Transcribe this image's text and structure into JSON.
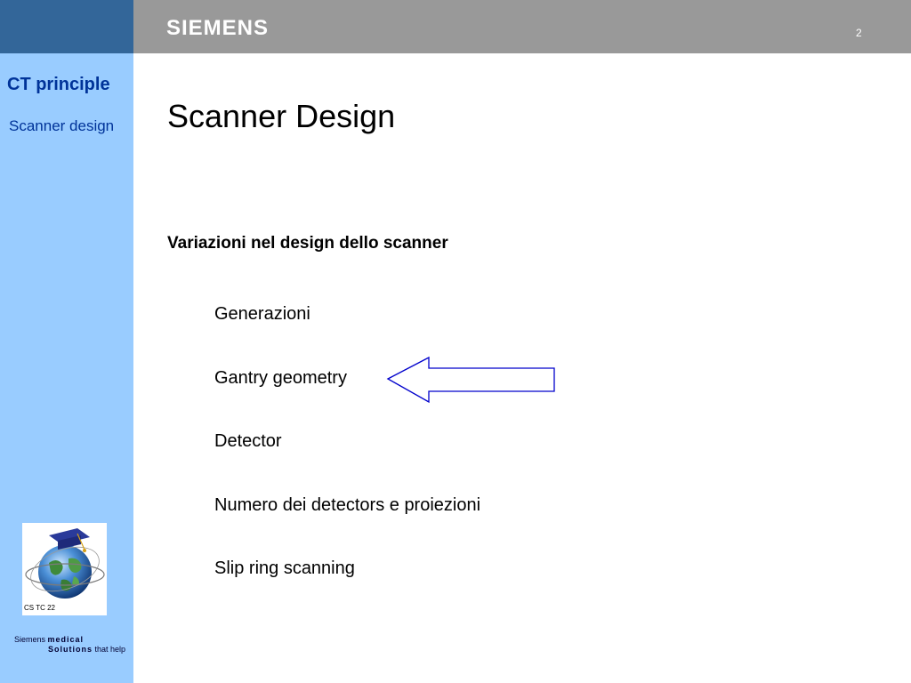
{
  "header": {
    "brand": "SIEMENS",
    "page_number": "2"
  },
  "sidebar": {
    "section_title": "CT principle",
    "section_subtitle": "Scanner design",
    "logo_caption": "CS TC 22",
    "footer": {
      "company": "Siemens",
      "word_medical": "medical",
      "word_solutions": "Solutions",
      "tagline_end": "that help"
    }
  },
  "slide": {
    "title": "Scanner Design",
    "subheading": "Variazioni nel design dello scanner",
    "bullets": [
      "Generazioni",
      "Gantry geometry",
      "Detector",
      "Numero dei detectors e proiezioni",
      "Slip ring scanning"
    ]
  },
  "colors": {
    "sidebar": "#99ccff",
    "sidebar_top": "#336699",
    "header_bar": "#999999",
    "section_text": "#003399",
    "arrow_stroke": "#0000cc"
  },
  "icons": {
    "arrow": "left-arrow-icon",
    "logo": "globe-graduation-cap-logo"
  }
}
